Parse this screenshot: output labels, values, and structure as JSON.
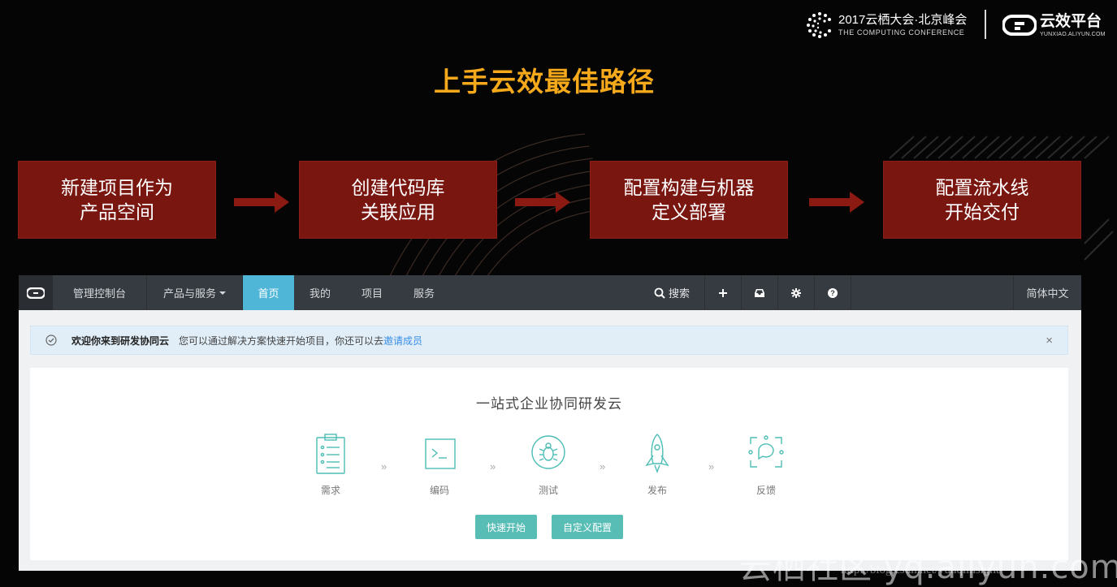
{
  "conference": {
    "title": "2017云栖大会·北京峰会",
    "subtitle": "THE COMPUTING CONFERENCE"
  },
  "yunxiao": {
    "name": "云效平台",
    "url": "YUNXIAO.ALIYUN.COM"
  },
  "slide_title": "上手云效最佳路径",
  "steps": [
    {
      "line1": "新建项目作为",
      "line2": "产品空间"
    },
    {
      "line1": "创建代码库",
      "line2": "关联应用"
    },
    {
      "line1": "配置构建与机器",
      "line2": "定义部署"
    },
    {
      "line1": "配置流水线",
      "line2": "开始交付"
    }
  ],
  "colors": {
    "title_accent": "#f5a91b",
    "step_box": "#7a1610",
    "nav_active": "#4fb6d8",
    "primary_button": "#58bdb5",
    "flow_icon": "#4dbdb5"
  },
  "nav": {
    "console": "管理控制台",
    "products": "产品与服务",
    "tabs": [
      "首页",
      "我的",
      "项目",
      "服务"
    ],
    "active_tab": "首页",
    "search": "搜索",
    "language": "简体中文",
    "icons": [
      "plus-icon",
      "inbox-icon",
      "gear-icon",
      "help-icon"
    ]
  },
  "notice": {
    "title": "欢迎你来到研发协同云",
    "message": "您可以通过解决方案快速开始项目，你还可以去",
    "link": "邀请成员",
    "close": "×"
  },
  "card": {
    "title": "一站式企业协同研发云",
    "flow": [
      "需求",
      "编码",
      "测试",
      "发布",
      "反馈"
    ],
    "flow_icons": [
      "clipboard-icon",
      "terminal-icon",
      "bug-icon",
      "rocket-icon",
      "feedback-icon"
    ],
    "chevron": "»",
    "buttons": {
      "quick_start": "快速开始",
      "custom_config": "自定义配置"
    }
  },
  "watermark": {
    "main": "云栖社区 yq.aliyun.com",
    "url": "http://blog.csdn.net/yunqiinsight"
  }
}
